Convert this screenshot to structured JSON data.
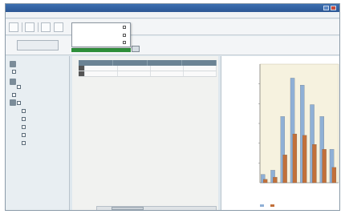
{
  "window": {
    "title": ""
  },
  "menu": {
    "items": [
      "",
      "",
      "",
      "",
      "",
      "",
      "",
      ""
    ]
  },
  "toolbar": {
    "address_placeholder": ""
  },
  "dropdown": {
    "items": [
      "",
      "",
      ""
    ]
  },
  "sidebar": {
    "items": [
      "",
      "",
      "",
      "",
      "",
      "",
      "",
      "",
      "",
      "",
      "",
      ""
    ]
  },
  "grid": {
    "columns": [
      "",
      "",
      "",
      ""
    ],
    "rows": [
      [
        "",
        "",
        "",
        ""
      ],
      [
        "",
        "",
        "",
        ""
      ]
    ]
  },
  "colors": {
    "series_a": "#8fb0d6",
    "series_b": "#c2703a",
    "plot_bg": "#f6f2df"
  },
  "chart_data": {
    "type": "bar",
    "categories": [
      "",
      "",
      "",
      "",
      "",
      "",
      "",
      ""
    ],
    "series": [
      {
        "values": [
          12,
          18,
          95,
          150,
          140,
          112,
          95,
          48
        ]
      },
      {
        "values": [
          5,
          8,
          40,
          70,
          68,
          55,
          48,
          22
        ]
      }
    ],
    "title": "",
    "xlabel": "",
    "ylabel": "",
    "ylim": [
      0,
      170
    ],
    "ytick_labels": [
      "",
      "",
      "",
      "",
      ""
    ],
    "grid": false,
    "legend": {
      "entries": [
        "",
        ""
      ],
      "placement": "bottom"
    }
  }
}
